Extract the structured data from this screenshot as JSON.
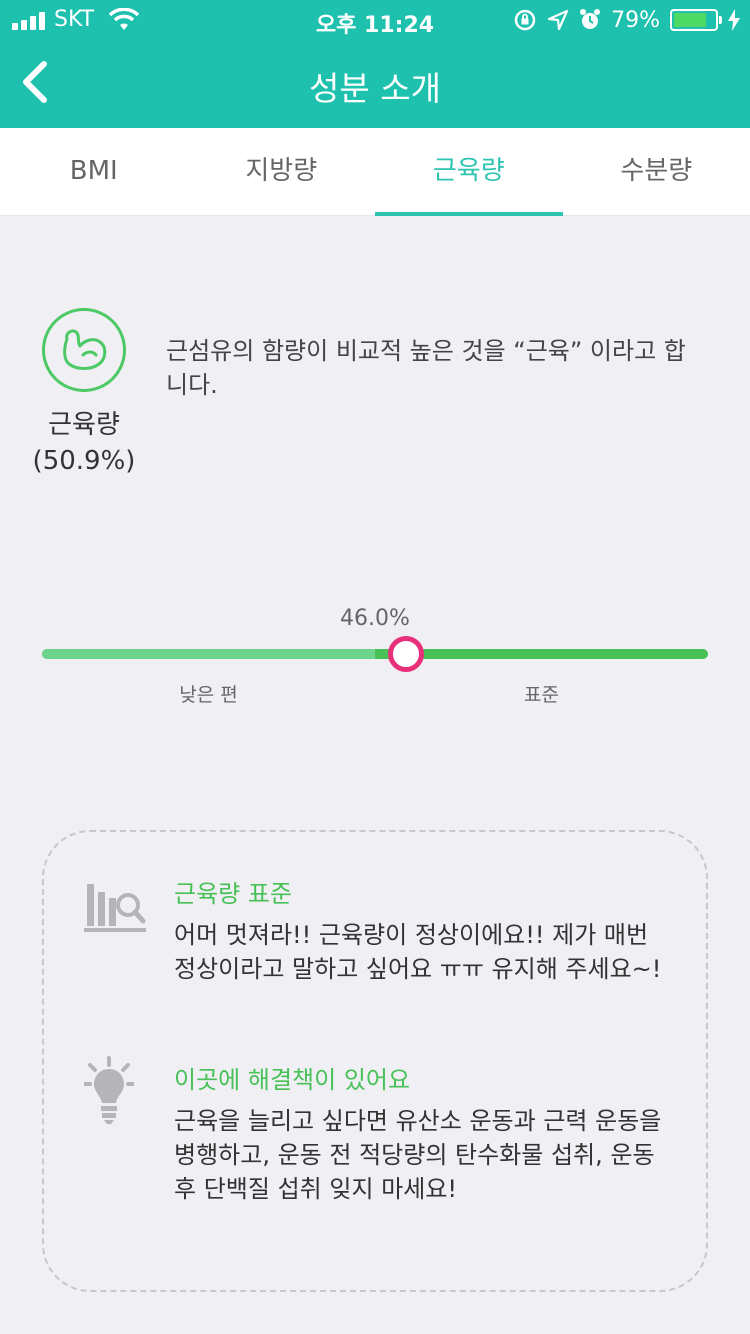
{
  "status_bar": {
    "carrier": "SKT",
    "time": "오후 11:24",
    "battery": "79%",
    "battery_level": 0.79
  },
  "nav": {
    "title": "성분 소개",
    "back_icon": "chevron-left-icon"
  },
  "tabs": [
    {
      "label": "BMI",
      "active": false
    },
    {
      "label": "지방량",
      "active": false
    },
    {
      "label": "근육량",
      "active": true
    },
    {
      "label": "수분량",
      "active": false
    }
  ],
  "metric": {
    "icon": "flexed-arm-icon",
    "name": "근육량",
    "percent": "(50.9%)",
    "description": "근섬유의 함량이 비교적 높은 것을 “근육” 이라고 합니다."
  },
  "gauge": {
    "value_label": "46.0%",
    "marker_position": 0.546,
    "low_segment": 0.5,
    "low_label": "낮은 편",
    "standard_label": "표준",
    "colors": {
      "low": "#6dd48e",
      "standard": "#48c157",
      "marker": "#e8307a"
    }
  },
  "advice": [
    {
      "icon": "bar-chart-search-icon",
      "title": "근육량 표준",
      "body": "어머 멋져라!! 근육량이 정상이에요!! 제가 매번 정상이라고 말하고 싶어요 ㅠㅠ 유지해 주세요~!"
    },
    {
      "icon": "lightbulb-icon",
      "title": "이곳에 해결책이 있어요",
      "body": "근육을 늘리고 싶다면 유산소 운동과 근력 운동을 병행하고, 운동 전 적당량의 탄수화물 섭취, 운동 후 단백질 섭취 잊지 마세요!"
    }
  ],
  "colors": {
    "primary": "#1ec1ae",
    "tab_active": "#2fc4b2",
    "accent_green": "#48c157"
  }
}
